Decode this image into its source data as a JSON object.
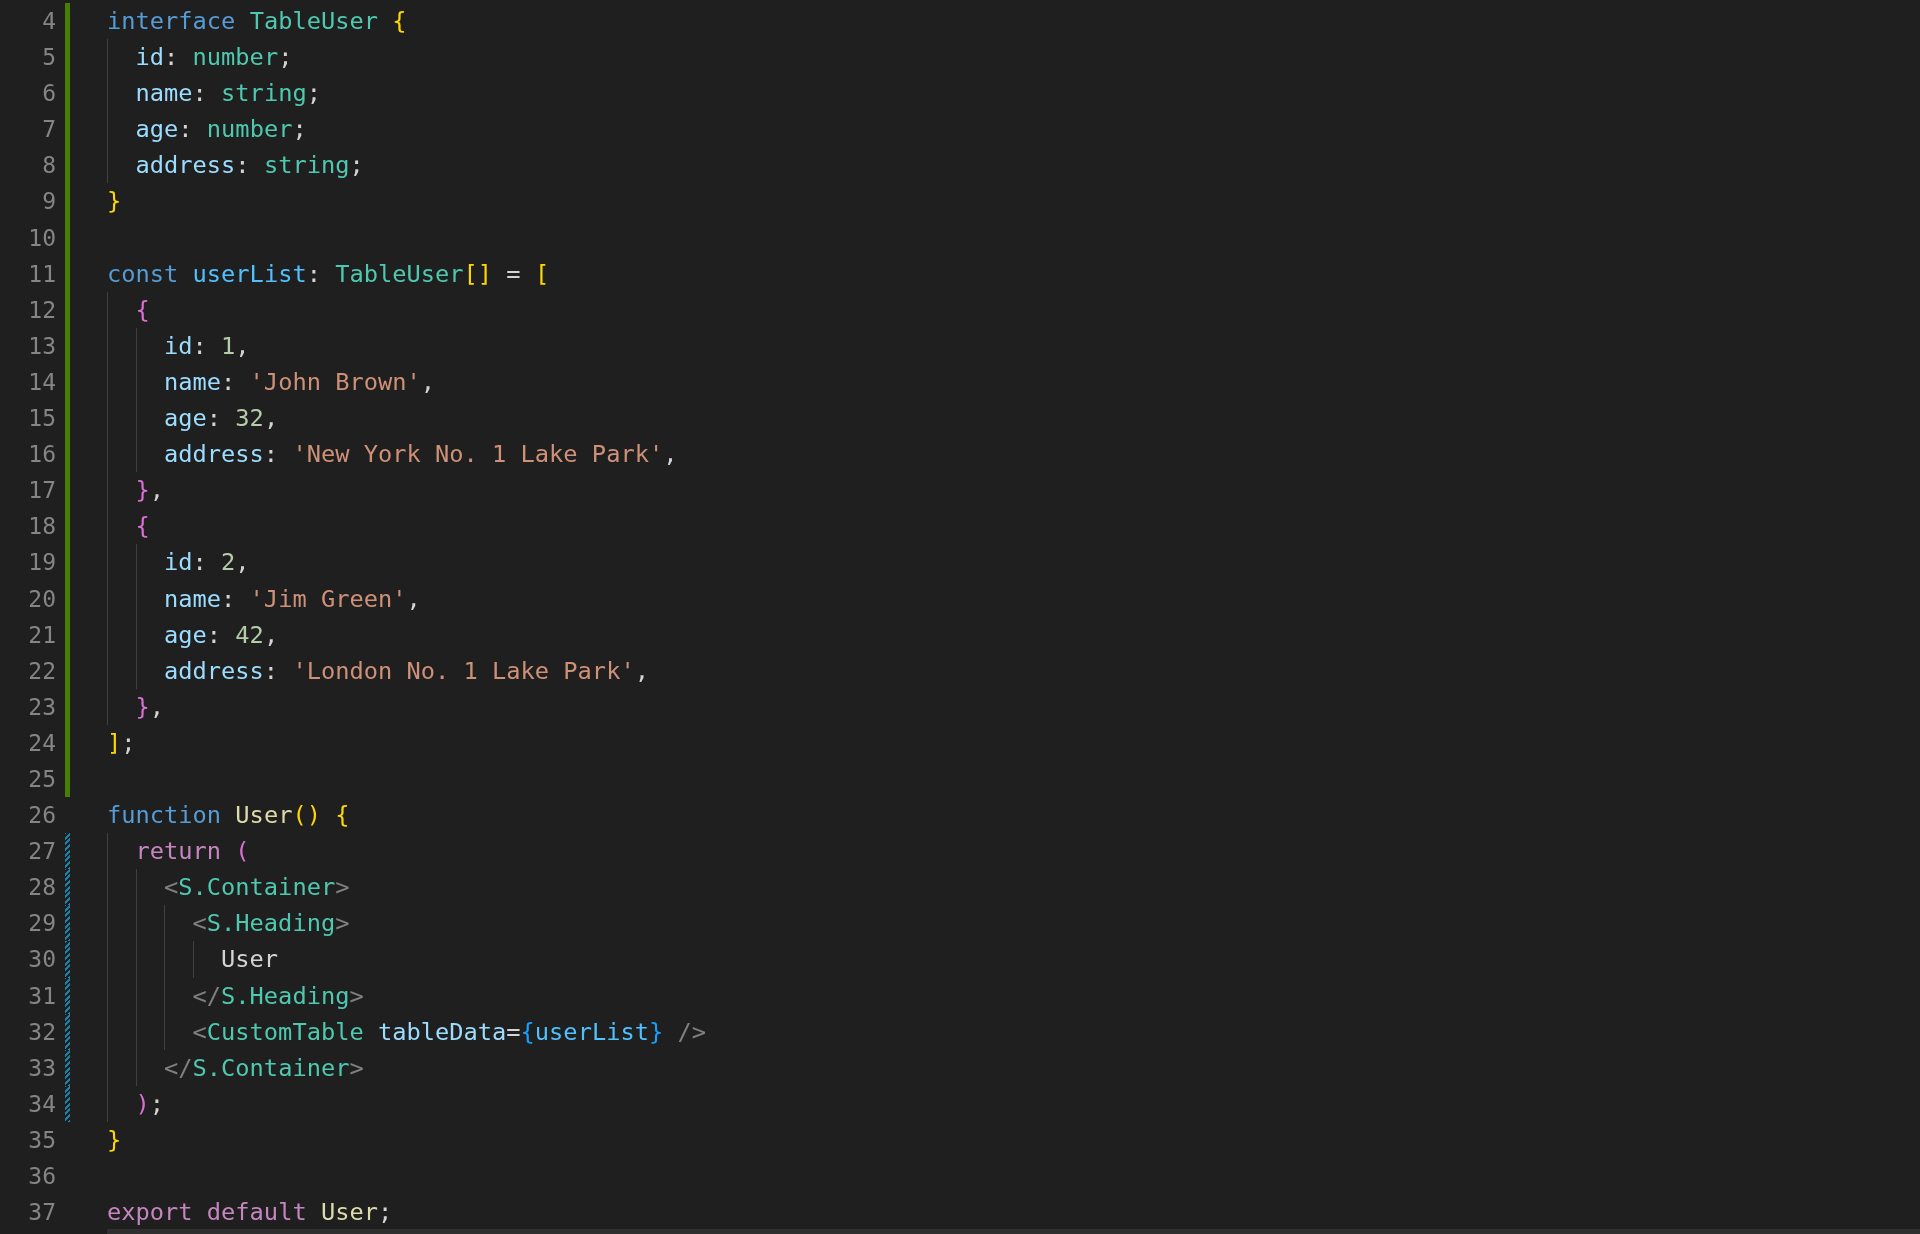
{
  "lines": [
    {
      "number": "4",
      "kind": "added",
      "tokens": [
        {
          "kind": "kw",
          "text": "interface "
        },
        {
          "kind": "type",
          "text": "TableUser "
        },
        {
          "kind": "br1",
          "text": "{"
        }
      ]
    },
    {
      "number": "5",
      "kind": "added",
      "tokens": [
        {
          "kind": "prop",
          "text": "  id"
        },
        {
          "kind": "punc",
          "text": ": "
        },
        {
          "kind": "type",
          "text": "number"
        },
        {
          "kind": "punc",
          "text": ";"
        }
      ]
    },
    {
      "number": "6",
      "kind": "added",
      "tokens": [
        {
          "kind": "prop",
          "text": "  name"
        },
        {
          "kind": "punc",
          "text": ": "
        },
        {
          "kind": "type",
          "text": "string"
        },
        {
          "kind": "punc",
          "text": ";"
        }
      ]
    },
    {
      "number": "7",
      "kind": "added",
      "tokens": [
        {
          "kind": "prop",
          "text": "  age"
        },
        {
          "kind": "punc",
          "text": ": "
        },
        {
          "kind": "type",
          "text": "number"
        },
        {
          "kind": "punc",
          "text": ";"
        }
      ]
    },
    {
      "number": "8",
      "kind": "added",
      "tokens": [
        {
          "kind": "prop",
          "text": "  address"
        },
        {
          "kind": "punc",
          "text": ": "
        },
        {
          "kind": "type",
          "text": "string"
        },
        {
          "kind": "punc",
          "text": ";"
        }
      ]
    },
    {
      "number": "9",
      "kind": "added",
      "tokens": [
        {
          "kind": "br1",
          "text": "}"
        }
      ]
    },
    {
      "number": "10",
      "kind": "added"
    },
    {
      "number": "11",
      "kind": "added",
      "tokens": [
        {
          "kind": "kw",
          "text": "const "
        },
        {
          "kind": "var",
          "text": "userList"
        },
        {
          "kind": "punc",
          "text": ": "
        },
        {
          "kind": "type",
          "text": "TableUser"
        },
        {
          "kind": "br1",
          "text": "[]"
        },
        {
          "kind": "punc",
          "text": " = "
        },
        {
          "kind": "br1",
          "text": "["
        }
      ]
    },
    {
      "number": "12",
      "kind": "added",
      "tokens": [
        {
          "kind": "br2",
          "text": "  {"
        }
      ]
    },
    {
      "number": "13",
      "kind": "added",
      "tokens": [
        {
          "kind": "prop",
          "text": "    id"
        },
        {
          "kind": "punc",
          "text": ": "
        },
        {
          "kind": "num",
          "text": "1"
        },
        {
          "kind": "punc",
          "text": ","
        }
      ]
    },
    {
      "number": "14",
      "kind": "added",
      "tokens": [
        {
          "kind": "prop",
          "text": "    name"
        },
        {
          "kind": "punc",
          "text": ": "
        },
        {
          "kind": "str",
          "text": "'John Brown'"
        },
        {
          "kind": "punc",
          "text": ","
        }
      ]
    },
    {
      "number": "15",
      "kind": "added",
      "tokens": [
        {
          "kind": "prop",
          "text": "    age"
        },
        {
          "kind": "punc",
          "text": ": "
        },
        {
          "kind": "num",
          "text": "32"
        },
        {
          "kind": "punc",
          "text": ","
        }
      ]
    },
    {
      "number": "16",
      "kind": "added",
      "tokens": [
        {
          "kind": "prop",
          "text": "    address"
        },
        {
          "kind": "punc",
          "text": ": "
        },
        {
          "kind": "str",
          "text": "'New York No. 1 Lake Park'"
        },
        {
          "kind": "punc",
          "text": ","
        }
      ]
    },
    {
      "number": "17",
      "kind": "added",
      "tokens": [
        {
          "kind": "br2",
          "text": "  }"
        },
        {
          "kind": "punc",
          "text": ","
        }
      ]
    },
    {
      "number": "18",
      "kind": "added",
      "tokens": [
        {
          "kind": "br2",
          "text": "  {"
        }
      ]
    },
    {
      "number": "19",
      "kind": "added",
      "tokens": [
        {
          "kind": "prop",
          "text": "    id"
        },
        {
          "kind": "punc",
          "text": ": "
        },
        {
          "kind": "num",
          "text": "2"
        },
        {
          "kind": "punc",
          "text": ","
        }
      ]
    },
    {
      "number": "20",
      "kind": "added",
      "tokens": [
        {
          "kind": "prop",
          "text": "    name"
        },
        {
          "kind": "punc",
          "text": ": "
        },
        {
          "kind": "str",
          "text": "'Jim Green'"
        },
        {
          "kind": "punc",
          "text": ","
        }
      ]
    },
    {
      "number": "21",
      "kind": "added",
      "tokens": [
        {
          "kind": "prop",
          "text": "    age"
        },
        {
          "kind": "punc",
          "text": ": "
        },
        {
          "kind": "num",
          "text": "42"
        },
        {
          "kind": "punc",
          "text": ","
        }
      ]
    },
    {
      "number": "22",
      "kind": "added",
      "tokens": [
        {
          "kind": "prop",
          "text": "    address"
        },
        {
          "kind": "punc",
          "text": ": "
        },
        {
          "kind": "str",
          "text": "'London No. 1 Lake Park'"
        },
        {
          "kind": "punc",
          "text": ","
        }
      ]
    },
    {
      "number": "23",
      "kind": "added",
      "tokens": [
        {
          "kind": "br2",
          "text": "  }"
        },
        {
          "kind": "punc",
          "text": ","
        }
      ]
    },
    {
      "number": "24",
      "kind": "added",
      "tokens": [
        {
          "kind": "br1",
          "text": "]"
        },
        {
          "kind": "punc",
          "text": ";"
        }
      ]
    },
    {
      "number": "25",
      "kind": "added"
    },
    {
      "number": "26",
      "kind": "plain",
      "tokens": [
        {
          "kind": "kw",
          "text": "function "
        },
        {
          "kind": "fn",
          "text": "User"
        },
        {
          "kind": "br1",
          "text": "() {"
        }
      ]
    },
    {
      "number": "27",
      "kind": "modified",
      "tokens": [
        {
          "kind": "ctrl",
          "text": "  return "
        },
        {
          "kind": "br2",
          "text": "("
        }
      ]
    },
    {
      "number": "28",
      "kind": "modified",
      "tokens": [
        {
          "kind": "tagp",
          "text": "    <"
        },
        {
          "kind": "type",
          "text": "S.Container"
        },
        {
          "kind": "tagp",
          "text": ">"
        }
      ]
    },
    {
      "number": "29",
      "kind": "modified",
      "tokens": [
        {
          "kind": "tagp",
          "text": "      <"
        },
        {
          "kind": "type",
          "text": "S.Heading"
        },
        {
          "kind": "tagp",
          "text": ">"
        }
      ]
    },
    {
      "number": "30",
      "kind": "modified",
      "tokens": [
        {
          "kind": "text",
          "text": "        User"
        }
      ]
    },
    {
      "number": "31",
      "kind": "modified",
      "tokens": [
        {
          "kind": "tagp",
          "text": "      </"
        },
        {
          "kind": "type",
          "text": "S.Heading"
        },
        {
          "kind": "tagp",
          "text": ">"
        }
      ]
    },
    {
      "number": "32",
      "kind": "modified",
      "tokens": [
        {
          "kind": "tagp",
          "text": "      <"
        },
        {
          "kind": "type",
          "text": "CustomTable "
        },
        {
          "kind": "prop",
          "text": "tableData"
        },
        {
          "kind": "punc",
          "text": "="
        },
        {
          "kind": "br3",
          "text": "{"
        },
        {
          "kind": "var2",
          "text": "userList"
        },
        {
          "kind": "br3",
          "text": "}"
        },
        {
          "kind": "tagp",
          "text": " />"
        }
      ]
    },
    {
      "number": "33",
      "kind": "modified",
      "tokens": [
        {
          "kind": "tagp",
          "text": "    </"
        },
        {
          "kind": "type",
          "text": "S.Container"
        },
        {
          "kind": "tagp",
          "text": ">"
        }
      ]
    },
    {
      "number": "34",
      "kind": "modified",
      "tokens": [
        {
          "kind": "br2",
          "text": "  )"
        },
        {
          "kind": "punc",
          "text": ";"
        }
      ]
    },
    {
      "number": "35",
      "kind": "plain",
      "tokens": [
        {
          "kind": "br1",
          "text": "}"
        }
      ]
    },
    {
      "number": "36",
      "kind": "plain"
    },
    {
      "number": "37",
      "kind": "plain",
      "tokens": [
        {
          "kind": "ctrl",
          "text": "export default "
        },
        {
          "kind": "fn",
          "text": "User"
        },
        {
          "kind": "punc",
          "text": ";"
        }
      ]
    }
  ]
}
